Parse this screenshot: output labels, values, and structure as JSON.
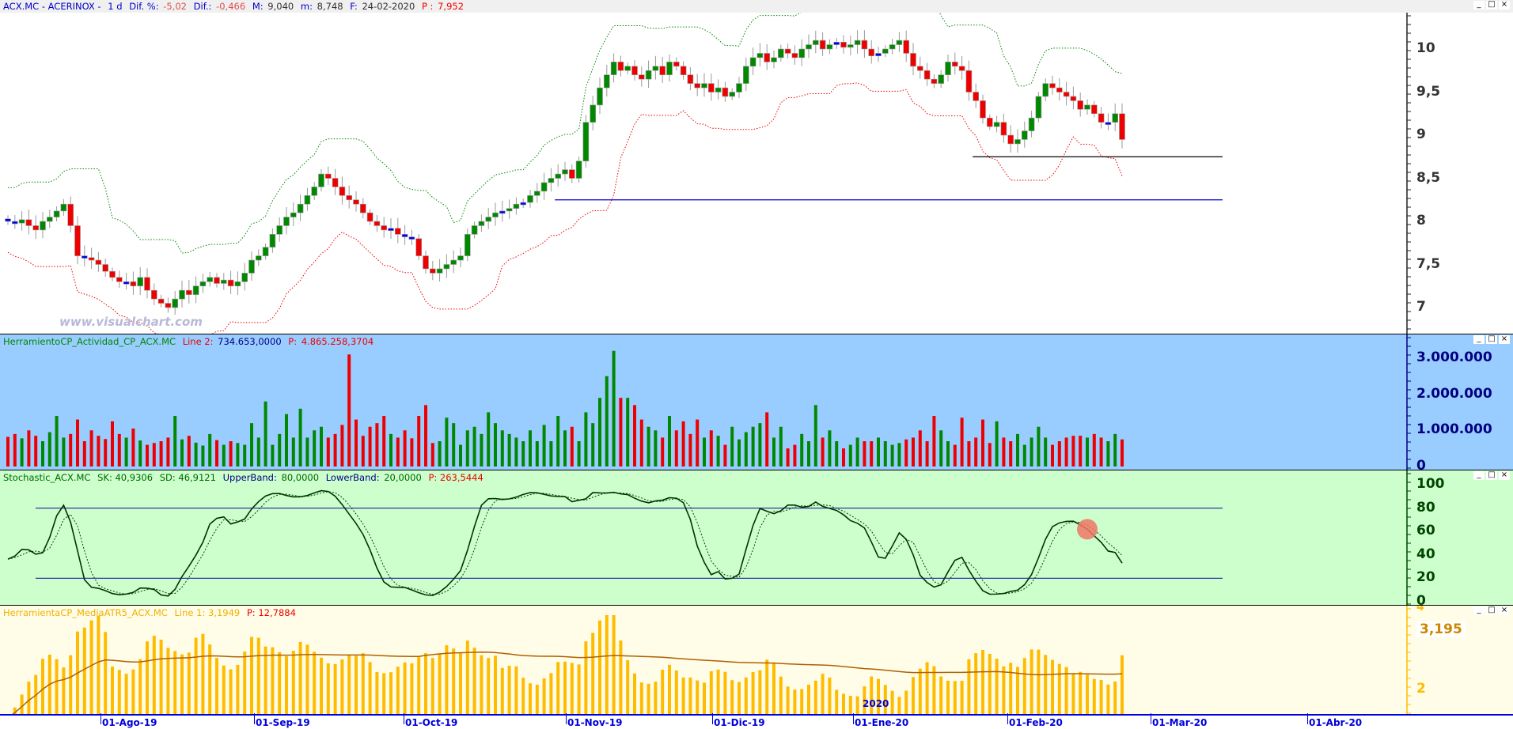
{
  "title": {
    "symbol": "ACX.MC - ACERINOX -",
    "period": "1 d",
    "dif_pct_label": "Dif. %:",
    "dif_pct": "-5,02",
    "dif_label": "Dif.:",
    "dif": "-0,466",
    "max_label": "M:",
    "max": "9,040",
    "min_label": "m:",
    "min": "8,748",
    "date_label": "F:",
    "date": "24-02-2020",
    "p_label": "P :",
    "p": "7,952"
  },
  "watermark": "www.visualchart.com",
  "window_controls": {
    "minimize": "_",
    "maximize": "□",
    "close": "×"
  },
  "price_axis": [
    "10",
    "9,5",
    "9",
    "8,5",
    "8",
    "7,5",
    "7"
  ],
  "volume_panel": {
    "name": "HerramientoCP_Actividad_CP_ACX.MC",
    "line_label": "Line 2:",
    "line_value": "734.653,0000",
    "p_label": "P:",
    "p_value": "4.865.258,3704",
    "axis": [
      "3.000.000",
      "2.000.000",
      "1.000.000",
      "0"
    ]
  },
  "stoch_panel": {
    "name": "Stochastic_ACX.MC",
    "sk": "SK: 40,9306",
    "sd": "SD: 46,9121",
    "upper_label": "UpperBand:",
    "upper": "80,0000",
    "lower_label": "LowerBand:",
    "lower": "20,0000",
    "p": "P: 263,5444",
    "axis": [
      "100",
      "80",
      "60",
      "40",
      "20",
      "0"
    ]
  },
  "atr_panel": {
    "name": "HerramientaCP_MediaATR5_ACX.MC",
    "line": "Line 1: 3,1949",
    "p": "P: 12,7884",
    "axis_top": "4",
    "current": "3,195",
    "axis_low": "2"
  },
  "x_axis": {
    "year_marker": "2020",
    "dates": [
      "01-Ago-19",
      "01-Sep-19",
      "01-Oct-19",
      "01-Nov-19",
      "01-Dic-19",
      "01-Ene-20",
      "01-Feb-20",
      "01-Mar-20",
      "01-Abr-20"
    ]
  },
  "colors": {
    "up": "#008800",
    "down": "#ee0000",
    "neutral": "#0000ee",
    "upper_band": "#008800",
    "lower_band": "#ee0000",
    "atr": "#ffbb00",
    "atr_avg": "#b06000"
  },
  "chart_data": {
    "type": "candlestick",
    "close": [
      8.0,
      7.98,
      8.02,
      7.95,
      7.9,
      8.0,
      8.05,
      8.12,
      8.2,
      7.95,
      7.6,
      7.58,
      7.55,
      7.5,
      7.42,
      7.35,
      7.3,
      7.3,
      7.25,
      7.35,
      7.2,
      7.1,
      7.05,
      7.0,
      7.1,
      7.2,
      7.15,
      7.25,
      7.3,
      7.35,
      7.28,
      7.32,
      7.25,
      7.3,
      7.4,
      7.55,
      7.6,
      7.7,
      7.85,
      7.95,
      8.05,
      8.1,
      8.2,
      8.3,
      8.4,
      8.55,
      8.5,
      8.4,
      8.3,
      8.25,
      8.2,
      8.1,
      8.0,
      7.95,
      7.9,
      7.92,
      7.85,
      7.82,
      7.8,
      7.6,
      7.45,
      7.4,
      7.45,
      7.5,
      7.55,
      7.6,
      7.85,
      7.95,
      8.0,
      8.05,
      8.1,
      8.12,
      8.15,
      8.2,
      8.22,
      8.3,
      8.35,
      8.45,
      8.5,
      8.55,
      8.6,
      8.5,
      8.7,
      9.15,
      9.35,
      9.55,
      9.7,
      9.85,
      9.75,
      9.8,
      9.7,
      9.65,
      9.75,
      9.8,
      9.7,
      9.85,
      9.8,
      9.7,
      9.6,
      9.55,
      9.6,
      9.5,
      9.55,
      9.45,
      9.5,
      9.6,
      9.8,
      9.9,
      9.95,
      9.85,
      9.9,
      10.0,
      9.95,
      9.9,
      10.0,
      10.05,
      10.1,
      10.0,
      10.05,
      10.08,
      10.02,
      10.05,
      10.1,
      10.0,
      9.92,
      9.95,
      10.0,
      10.05,
      10.1,
      9.95,
      9.8,
      9.75,
      9.65,
      9.6,
      9.7,
      9.85,
      9.8,
      9.75,
      9.5,
      9.4,
      9.2,
      9.1,
      9.15,
      9.0,
      8.9,
      8.95,
      9.05,
      9.2,
      9.45,
      9.6,
      9.55,
      9.5,
      9.45,
      9.4,
      9.3,
      9.35,
      9.25,
      9.15,
      9.15,
      9.25,
      8.95
    ],
    "volume_thousands": [
      820,
      900,
      780,
      1000,
      850,
      700,
      950,
      1400,
      800,
      900,
      1300,
      700,
      1000,
      850,
      760,
      1250,
      900,
      800,
      1050,
      720,
      600,
      650,
      700,
      800,
      1400,
      750,
      850,
      660,
      580,
      900,
      730,
      600,
      700,
      650,
      600,
      1200,
      800,
      1800,
      600,
      900,
      1450,
      800,
      1600,
      800,
      1000,
      1100,
      800,
      900,
      1150,
      3100,
      1300,
      850,
      1100,
      1200,
      1400,
      900,
      800,
      1000,
      780,
      1400,
      1700,
      650,
      700,
      1350,
      1200,
      600,
      1000,
      1100,
      900,
      1500,
      1200,
      1000,
      900,
      800,
      700,
      1000,
      700,
      1150,
      700,
      1400,
      1000,
      1100,
      700,
      1500,
      1200,
      1900,
      2500,
      3200,
      1900,
      1900,
      1700,
      1300,
      1100,
      1000,
      800,
      1400,
      1000,
      1250,
      900,
      1300,
      800,
      1000,
      850,
      600,
      1100,
      750,
      950,
      1100,
      1200,
      1500,
      800,
      1100,
      500,
      600,
      900,
      700,
      1700,
      800,
      1000,
      700,
      500,
      600,
      800,
      700,
      700,
      800,
      700,
      600,
      650,
      750,
      800,
      1000,
      700,
      1400,
      1000,
      700,
      600,
      1350,
      700,
      800,
      1300,
      650,
      1250,
      800,
      700,
      900,
      600,
      800,
      1100,
      800,
      600,
      700,
      800,
      850,
      850,
      800,
      900,
      800,
      700,
      900,
      750
    ],
    "support_lines": [
      {
        "price": 8.25,
        "color": "#0000cc",
        "from_bar": 79
      },
      {
        "price": 8.75,
        "color": "#000000",
        "from_bar": 139
      }
    ],
    "price_range": [
      6.65,
      10.42
    ],
    "stoch_bands": [
      80,
      20
    ]
  }
}
